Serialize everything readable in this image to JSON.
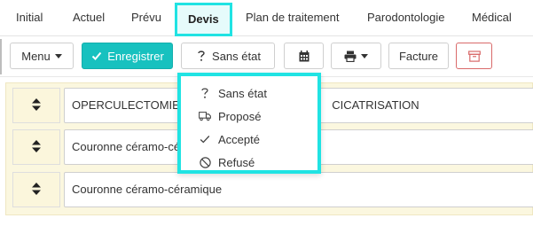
{
  "tabs": [
    {
      "label": "Initial"
    },
    {
      "label": "Actuel"
    },
    {
      "label": "Prévu"
    },
    {
      "label": "Devis",
      "active": true
    },
    {
      "label": "Plan de traitement"
    },
    {
      "label": "Parodontologie"
    },
    {
      "label": "Médical"
    }
  ],
  "toolbar": {
    "menu_label": "Menu",
    "save_label": "Enregistrer",
    "status_label": "Sans état",
    "invoice_label": "Facture"
  },
  "rows": [
    {
      "text": "OPERCULECTOMIE GI",
      "text_tail": "CICATRISATION"
    },
    {
      "text": "Couronne céramo-cé"
    },
    {
      "text": "Couronne céramo-céramique"
    }
  ],
  "status_menu": {
    "items": [
      {
        "label": "Sans état",
        "icon": "question-icon"
      },
      {
        "label": "Proposé",
        "icon": "truck-icon"
      },
      {
        "label": "Accepté",
        "icon": "check-icon"
      },
      {
        "label": "Refusé",
        "icon": "ban-icon"
      }
    ]
  },
  "colors": {
    "accent": "#17c1bf",
    "highlight": "#20e3e3",
    "row_background": "#fbf7df",
    "danger": "#d96a6a"
  }
}
